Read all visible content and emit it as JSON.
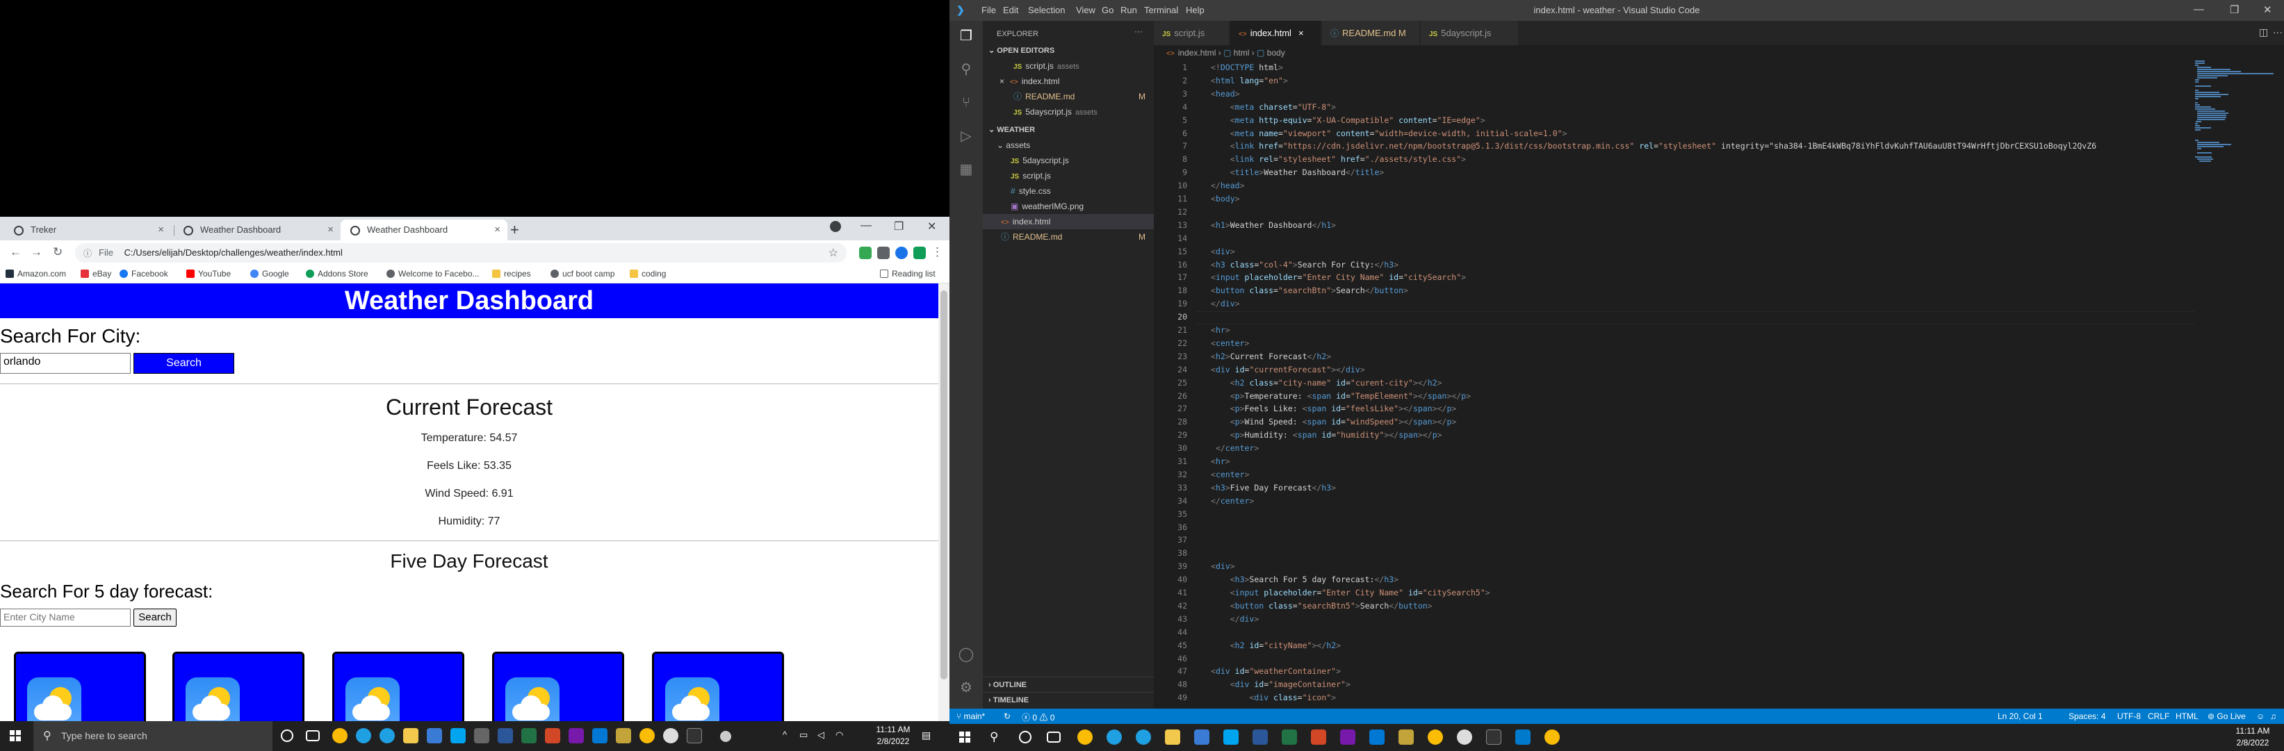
{
  "chrome": {
    "tabs": [
      {
        "label": "Treker"
      },
      {
        "label": "Weather Dashboard"
      },
      {
        "label": "Weather Dashboard"
      }
    ],
    "url_scheme": "File",
    "url": "C:/Users/elijah/Desktop/challenges/weather/index.html",
    "bookmarks": [
      "Amazon.com",
      "eBay",
      "Facebook",
      "YouTube",
      "Google",
      "Addons Store",
      "Welcome to Facebo...",
      "recipes",
      "ucf boot camp",
      "coding"
    ],
    "reading_list": "Reading list"
  },
  "page": {
    "header": "Weather Dashboard",
    "search_heading": "Search For City:",
    "search_value": "orlando",
    "search_button": "Search",
    "current_title": "Current Forecast",
    "temperature": "Temperature: 54.57",
    "feels_like": "Feels Like: 53.35",
    "wind": "Wind Speed: 6.91",
    "humidity": "Humidity: 77",
    "five_day_title": "Five Day Forecast",
    "search5_heading": "Search For 5 day forecast:",
    "search5_placeholder": "Enter City Name",
    "search5_button": "Search",
    "card_color": "#0000ff"
  },
  "taskbar_left": {
    "search_placeholder": "Type here to search",
    "time": "11:11 AM",
    "date": "2/8/2022"
  },
  "vscode": {
    "menu": [
      "File",
      "Edit",
      "Selection",
      "View",
      "Go",
      "Run",
      "Terminal",
      "Help"
    ],
    "title": "index.html - weather - Visual Studio Code",
    "explorer_label": "EXPLORER",
    "open_editors_label": "OPEN EDITORS",
    "open_editors": [
      {
        "name": "script.js",
        "hint": "assets",
        "type": "js",
        "badge": ""
      },
      {
        "name": "index.html",
        "hint": "",
        "type": "html",
        "badge": "",
        "close": "×"
      },
      {
        "name": "README.md",
        "hint": "",
        "type": "info",
        "badge": "M"
      },
      {
        "name": "5dayscript.js",
        "hint": "assets",
        "type": "js",
        "badge": ""
      }
    ],
    "workspace_label": "WEATHER",
    "tree": [
      {
        "name": "assets",
        "type": "folder",
        "depth": 1,
        "badge": ""
      },
      {
        "name": "5dayscript.js",
        "type": "js",
        "depth": 2,
        "badge": ""
      },
      {
        "name": "script.js",
        "type": "js",
        "depth": 2,
        "badge": ""
      },
      {
        "name": "style.css",
        "type": "css",
        "depth": 2,
        "badge": ""
      },
      {
        "name": "weatherIMG.png",
        "type": "img",
        "depth": 2,
        "badge": ""
      },
      {
        "name": "index.html",
        "type": "html",
        "depth": 1,
        "badge": ""
      },
      {
        "name": "README.md",
        "type": "info",
        "depth": 1,
        "badge": "M"
      }
    ],
    "outline_label": "OUTLINE",
    "timeline_label": "TIMELINE",
    "tabs": [
      {
        "label": "script.js",
        "type": "js"
      },
      {
        "label": "index.html",
        "type": "html",
        "close": "×"
      },
      {
        "label": "README.md M",
        "type": "info"
      },
      {
        "label": "5dayscript.js",
        "type": "js"
      }
    ],
    "breadcrumb": [
      "index.html",
      "html",
      "body"
    ],
    "code": [
      "<!DOCTYPE html>",
      "<html lang=\"en\">",
      "<head>",
      "    <meta charset=\"UTF-8\">",
      "    <meta http-equiv=\"X-UA-Compatible\" content=\"IE=edge\">",
      "    <meta name=\"viewport\" content=\"width=device-width, initial-scale=1.0\">",
      "    <link href=\"https://cdn.jsdelivr.net/npm/bootstrap@5.1.3/dist/css/bootstrap.min.css\" rel=\"stylesheet\" integrity=\"sha384-1BmE4kWBq78iYhFldvKuhfTAU6auU8tT94WrHftjDbrCEXSU1oBoqyl2QvZ6",
      "    <link rel=\"stylesheet\" href=\"./assets/style.css\">",
      "    <title>Weather Dashboard</title>",
      "</head>",
      "<body>",
      "",
      "<h1>Weather Dashboard</h1>",
      "",
      "<div>",
      "<h3 class=\"col-4\">Search For City:</h3>",
      "<input placeholder=\"Enter City Name\" id=\"citySearch\">",
      "<button class=\"searchBtn\">Search</button>",
      "</div>",
      "",
      "<hr>",
      "<center>",
      "<h2>Current Forecast</h2>",
      "<div id=\"currentForecast\"></div>",
      "    <h2 class=\"city-name\" id=\"curent-city\"></h2>",
      "    <p>Temperature: <span id=\"TempElement\"></span></p>",
      "    <p>Feels Like: <span id=\"feelsLike\"></span></p>",
      "    <p>Wind Speed: <span id=\"windSpeed\"></span></p>",
      "    <p>Humidity: <span id=\"humidity\"></span></p>",
      " </center>",
      "<hr>",
      "<center>",
      "<h3>Five Day Forecast</h3>",
      "</center>",
      "",
      "",
      "",
      "",
      "<div>",
      "    <h3>Search For 5 day forecast:</h3>",
      "    <input placeholder=\"Enter City Name\" id=\"citySearch5\">",
      "    <button class=\"searchBtn5\">Search</button>",
      "    </div>",
      "",
      "    <h2 id=\"cityName\"></h2>",
      "",
      "<div id=\"weatherContainer\">",
      "    <div id=\"imageContainer\">",
      "        <div class=\"icon\">"
    ],
    "status": {
      "branch": "main*",
      "errors": "0",
      "warnings": "0",
      "position": "Ln 20, Col 1",
      "spaces": "Spaces: 4",
      "encoding": "UTF-8",
      "eol": "CRLF",
      "language": "HTML",
      "golive": "Go Live"
    }
  },
  "taskbar_right": {
    "time": "11:11 AM",
    "date": "2/8/2022"
  },
  "colors": {
    "page_blue": "#0000ff",
    "vscode_status": "#007acc",
    "vscode_bg": "#1e1e1e"
  }
}
